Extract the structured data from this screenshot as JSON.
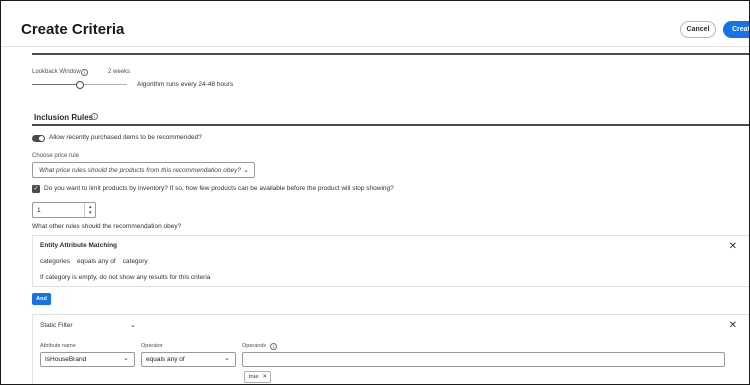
{
  "header": {
    "title": "Create Criteria",
    "cancel_label": "Cancel",
    "create_label": "Create"
  },
  "lookback": {
    "label": "Lookback Window",
    "value": "2 weeks",
    "slider_fraction": 0.5,
    "algorithm_note": "Algorithm runs every 24-48 hours"
  },
  "inclusion": {
    "heading": "Inclusion Rules",
    "allow_recent_label": "Allow recently purchased items to be recommended?",
    "allow_recent_on": true,
    "price_rule_label": "Choose price rule",
    "price_rule_placeholder": "What price rules should the products from this recommendation obey?",
    "limit_inventory_label": "Do you want to limit products by inventory? If so, how few products can be available before the product will stop showing?",
    "limit_inventory_checked": true,
    "inventory_value": "1",
    "other_rules_label": "What other rules should the recommendation obey?"
  },
  "entity_attribute_matching": {
    "title": "Entity Attribute Matching",
    "attribute": "categories",
    "operator": "equals any of",
    "value": "category",
    "note": "If category is empty, do not show any results for this criteria"
  },
  "and_label": "And",
  "static_filter": {
    "title": "Static Filter",
    "attribute_name_label": "Attribute name",
    "attribute_name_value": "IsHouseBrand",
    "operator_label": "Operator",
    "operator_value": "equals any of",
    "operands_label": "Operands",
    "operand_chip": "true"
  },
  "colors": {
    "accent": "#1473e6",
    "dark": "#4b4b4b"
  }
}
